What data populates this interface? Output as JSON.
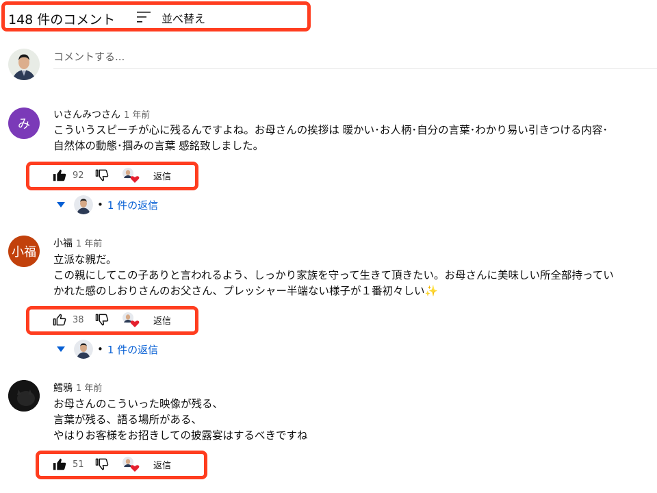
{
  "header": {
    "count_label": "148 件のコメント",
    "sort_label": "並べ替え",
    "sort_icon": "sort-icon"
  },
  "add_comment": {
    "placeholder": "コメントする..."
  },
  "comments": [
    {
      "author": "いさんみつさん",
      "time": "1 年前",
      "avatar_letter": "み",
      "avatar_color": "#7b3ab8",
      "text": [
        "こういうスピーチが心に残るんですよね。お母さんの挨拶は 暖かい･お人柄･自分の言葉･わかり易い引きつける内容･",
        "自然体の動態･掴みの言葉  感銘致しました。"
      ],
      "likes": "92",
      "liked": true,
      "reply_label": "返信",
      "replies_label": "1 件の返信"
    },
    {
      "author": "小福",
      "time": "1 年前",
      "avatar_letter": "小福",
      "avatar_color": "#c2410c",
      "text": [
        "立派な親だ。",
        "この親にしてこの子ありと言われるよう、しっかり家族を守って生きて頂きたい。お母さんに美味しい所全部持ってい",
        "かれた感のしおりさんのお父さん、プレッシャー半端ない様子が１番初々しい✨"
      ],
      "likes": "38",
      "liked": false,
      "reply_label": "返信",
      "replies_label": "1 件の返信"
    },
    {
      "author": "鱈鴉",
      "time": "1 年前",
      "avatar_letter": "",
      "avatar_color": "#1a1a1a",
      "text": [
        "お母さんのこういった映像が残る、",
        "言葉が残る、語る場所がある、",
        "やはりお客様をお招きしての披露宴はするべきですね"
      ],
      "likes": "51",
      "liked": true,
      "reply_label": "返信"
    }
  ],
  "colors": {
    "highlight": "#ff3d1f",
    "link": "#065fd4",
    "heart": "#e5202e"
  }
}
